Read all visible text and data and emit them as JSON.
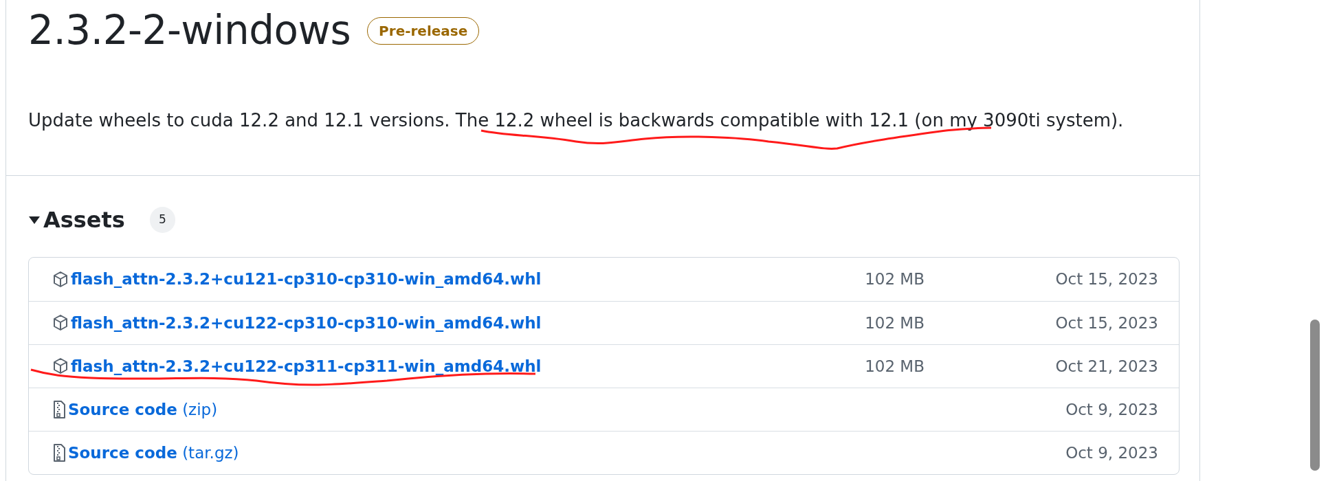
{
  "release": {
    "title": "2.3.2-2-windows",
    "badge": "Pre-release",
    "description": "Update wheels to cuda 12.2 and 12.1 versions. The 12.2 wheel is backwards compatible with 12.1 (on my 3090ti system)."
  },
  "assets": {
    "heading": "Assets",
    "count": "5",
    "expanded": true,
    "rows": [
      {
        "kind": "package",
        "label": "flash_attn-2.3.2+cu121-cp310-cp310-win_amd64.whl",
        "size": "102 MB",
        "date": "Oct 15, 2023"
      },
      {
        "kind": "package",
        "label": "flash_attn-2.3.2+cu122-cp310-cp310-win_amd64.whl",
        "size": "102 MB",
        "date": "Oct 15, 2023"
      },
      {
        "kind": "package",
        "label": "flash_attn-2.3.2+cu122-cp311-cp311-win_amd64.whl",
        "size": "102 MB",
        "date": "Oct 21, 2023"
      },
      {
        "kind": "source",
        "label": "**Source code** (zip)",
        "date": "Oct 9, 2023"
      },
      {
        "kind": "source",
        "label": "**Source code** (tar.gz)",
        "date": "Oct 9, 2023"
      }
    ]
  }
}
